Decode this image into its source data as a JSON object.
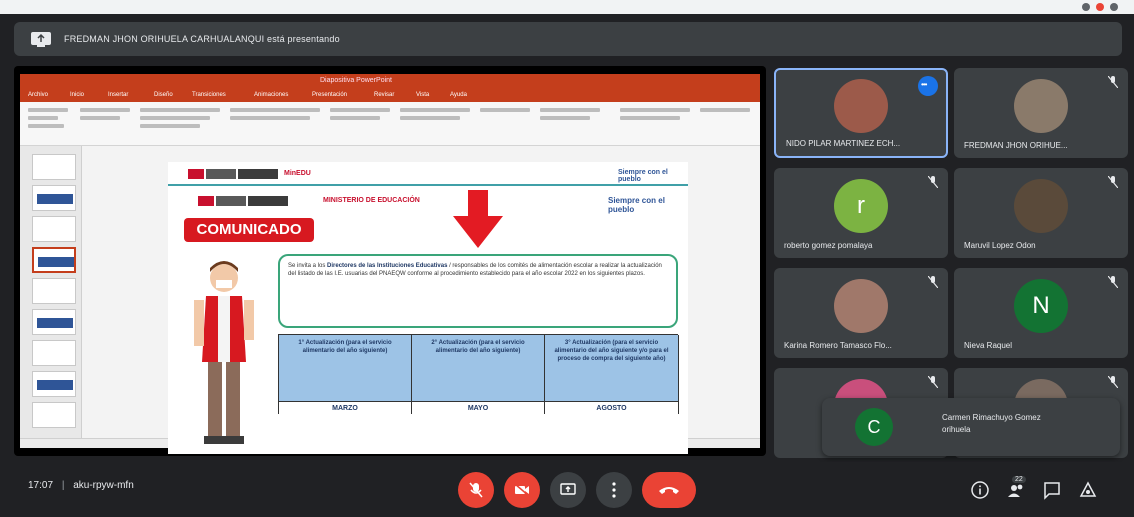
{
  "banner": {
    "text": "FREDMAN JHON ORIHUELA CARHUALANQUI está presentando"
  },
  "presentation": {
    "app_title": "Diapositiva PowerPoint",
    "tabs": [
      "Archivo",
      "Inicio",
      "Insertar",
      "Diseño",
      "Transiciones",
      "Animaciones",
      "Presentación",
      "Revisar",
      "Vista",
      "Ayuda"
    ],
    "slide": {
      "ministry": "MINISTERIO DE EDUCACIÓN",
      "brand": "MinEDU",
      "siempre": "Siempre con el pueblo",
      "comunicado": "COMUNICADO",
      "message_intro": "Se invita a los ",
      "message_bold1": "Directores de las Instituciones Educativas",
      "message_mid": " / responsables de los comités de alimentación escolar a realizar la actualización del listado de las I.E. usuarias del PNAEQW conforme al procedimiento establecido para el año escolar 2022 en los siguientes plazos.",
      "table": [
        {
          "head": "1° Actualización (para el servicio alimentario del año siguiente)",
          "month": "MARZO"
        },
        {
          "head": "2° Actualización (para el servicio alimentario del año siguiente)",
          "month": "MAYO"
        },
        {
          "head": "3° Actualización (para el servicio alimentario del año siguiente y/o para el proceso de compra del siguiente año)",
          "month": "AGOSTO"
        }
      ]
    }
  },
  "participants": [
    {
      "name": "NIDO PILAR MARTINEZ ECH...",
      "type": "photo",
      "active": true,
      "color": "#9c5a4a"
    },
    {
      "name": "FREDMAN JHON ORIHUE...",
      "type": "photo",
      "active": false,
      "color": "#8a7a6a"
    },
    {
      "name": "roberto gomez pomalaya",
      "type": "letter",
      "letter": "r",
      "color": "#7cb342"
    },
    {
      "name": "Maruvil Lopez Odon",
      "type": "photo",
      "active": false,
      "color": "#5a4a3a"
    },
    {
      "name": "Karina Romero Tamasco Flo...",
      "type": "photo",
      "active": false,
      "color": "#a0786a"
    },
    {
      "name": "Nieva Raquel",
      "type": "letter",
      "letter": "N",
      "color": "#137333"
    },
    {
      "name": "",
      "type": "photo-pair",
      "active": false,
      "color": "#c94f7c"
    },
    {
      "name": "",
      "type": "photo",
      "active": false,
      "color": "#7a6a60"
    }
  ],
  "floater": {
    "letter": "C",
    "name": "Carmen Rimachuyo Gomez orihuela"
  },
  "bottom": {
    "time": "17:07",
    "separator": "|",
    "meeting_code": "aku-rpyw-mfn",
    "people_count": "22"
  },
  "colors": {
    "bg": "#202124",
    "tile": "#3c4043",
    "red": "#ea4335",
    "accent": "#8ab4f8"
  }
}
